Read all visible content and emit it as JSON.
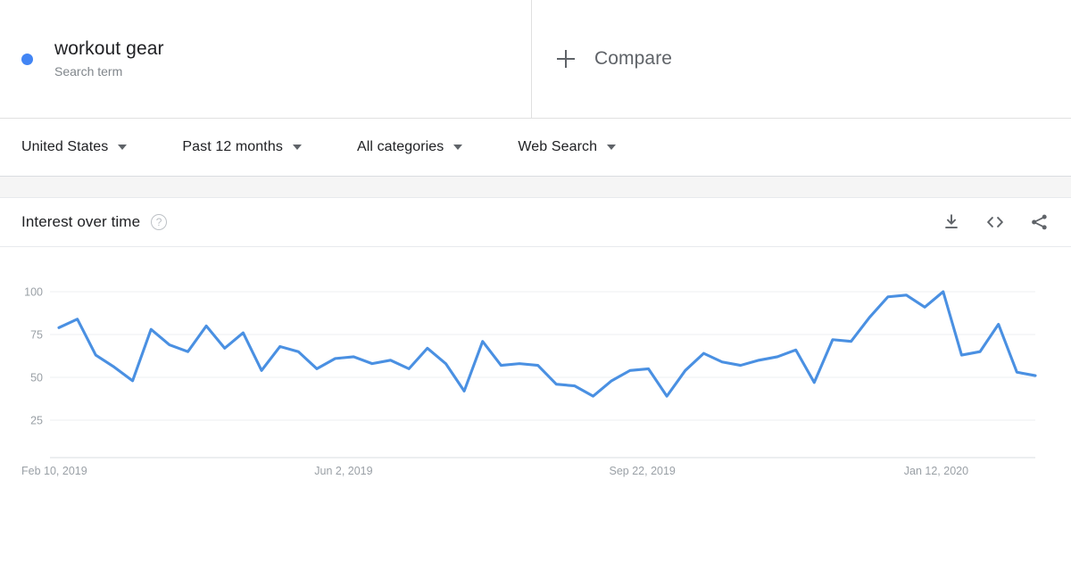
{
  "term": {
    "dot_color": "#4285f4",
    "title": "workout gear",
    "subtitle": "Search term"
  },
  "compare": {
    "label": "Compare",
    "icon": "plus-icon"
  },
  "filters": [
    {
      "label": "United States"
    },
    {
      "label": "Past 12 months"
    },
    {
      "label": "All categories"
    },
    {
      "label": "Web Search"
    }
  ],
  "card": {
    "title": "Interest over time",
    "help_icon": "?",
    "actions": [
      {
        "name": "download-icon",
        "label": "Download"
      },
      {
        "name": "embed-icon",
        "label": "Embed"
      },
      {
        "name": "share-icon",
        "label": "Share"
      }
    ]
  },
  "chart_data": {
    "type": "line",
    "title": "Interest over time",
    "xlabel": "",
    "ylabel": "",
    "ylim": [
      0,
      105
    ],
    "yticks": [
      25,
      50,
      75,
      100
    ],
    "grid": true,
    "legend": "none",
    "line_color": "#4a90e2",
    "xtick_labels": [
      "Feb 10, 2019",
      "Jun 2, 2019",
      "Sep 22, 2019",
      "Jan 12, 2020"
    ],
    "xtick_positions": [
      0,
      16,
      32,
      48
    ],
    "x": [
      "Feb 10, 2019",
      "Feb 17, 2019",
      "Feb 24, 2019",
      "Mar 3, 2019",
      "Mar 10, 2019",
      "Mar 17, 2019",
      "Mar 24, 2019",
      "Mar 31, 2019",
      "Apr 7, 2019",
      "Apr 14, 2019",
      "Apr 21, 2019",
      "Apr 28, 2019",
      "May 5, 2019",
      "May 12, 2019",
      "May 19, 2019",
      "May 26, 2019",
      "Jun 2, 2019",
      "Jun 9, 2019",
      "Jun 16, 2019",
      "Jun 23, 2019",
      "Jun 30, 2019",
      "Jul 7, 2019",
      "Jul 14, 2019",
      "Jul 21, 2019",
      "Jul 28, 2019",
      "Aug 4, 2019",
      "Aug 11, 2019",
      "Aug 18, 2019",
      "Aug 25, 2019",
      "Sep 1, 2019",
      "Sep 8, 2019",
      "Sep 15, 2019",
      "Sep 22, 2019",
      "Sep 29, 2019",
      "Oct 6, 2019",
      "Oct 13, 2019",
      "Oct 20, 2019",
      "Oct 27, 2019",
      "Nov 3, 2019",
      "Nov 10, 2019",
      "Nov 17, 2019",
      "Nov 24, 2019",
      "Dec 1, 2019",
      "Dec 8, 2019",
      "Dec 15, 2019",
      "Dec 22, 2019",
      "Dec 29, 2019",
      "Jan 5, 2020",
      "Jan 12, 2020",
      "Jan 19, 2020",
      "Jan 26, 2020",
      "Feb 2, 2020"
    ],
    "values": [
      79,
      84,
      63,
      56,
      48,
      78,
      69,
      65,
      80,
      67,
      76,
      54,
      68,
      65,
      55,
      61,
      62,
      58,
      60,
      55,
      67,
      58,
      42,
      71,
      57,
      58,
      57,
      46,
      45,
      39,
      48,
      54,
      55,
      39,
      54,
      64,
      59,
      57,
      60,
      62,
      66,
      47,
      72,
      71,
      85,
      97,
      98,
      91,
      100,
      63,
      65,
      81
    ],
    "tail_values": [
      53,
      51
    ],
    "max_value": 100,
    "min_value": 39
  }
}
